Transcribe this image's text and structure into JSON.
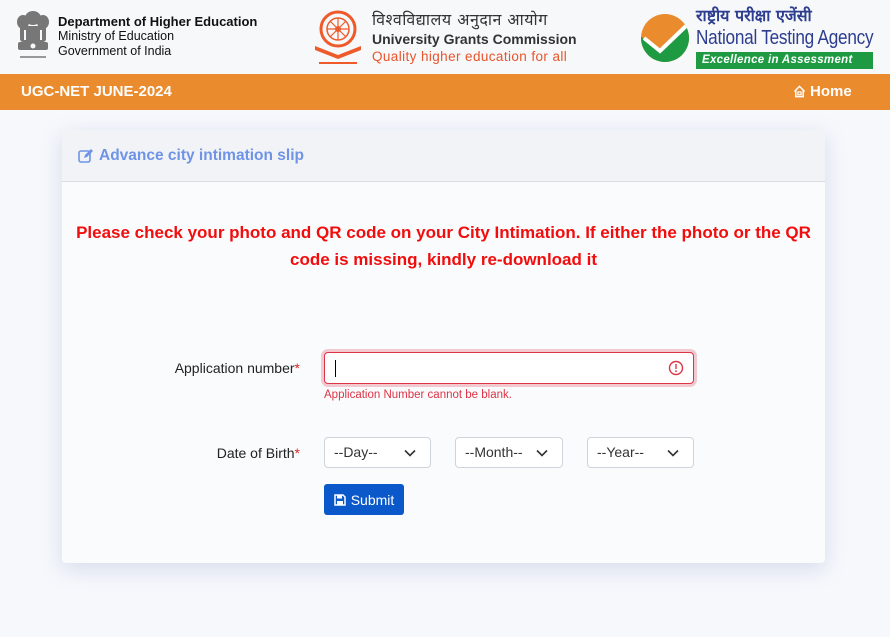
{
  "header": {
    "dhe": {
      "title": "Department of Higher Education",
      "line1": "Ministry of Education",
      "line2": "Government of India"
    },
    "ugc": {
      "hindi": "विश्वविद्यालय अनुदान आयोग",
      "english": "University Grants Commission",
      "tagline": "Quality higher education for all"
    },
    "nta": {
      "hindi": "राष्ट्रीय परीक्षा एजेंसी",
      "english": "National Testing Agency",
      "tagline": "Excellence in Assessment"
    }
  },
  "navbar": {
    "title": "UGC-NET JUNE-2024",
    "home_label": "Home",
    "color": "#ea8b2e"
  },
  "card": {
    "title": "Advance city intimation slip",
    "notice": "Please check your photo and QR code on your City Intimation. If either the photo or the QR code is missing, kindly re-download it",
    "form": {
      "application_label": "Application number",
      "required_mark": "*",
      "application_value": "",
      "application_error": "Application Number cannot be blank.",
      "dob_label": "Date of Birth",
      "day_selected": "--Day--",
      "month_selected": "--Month--",
      "year_selected": "--Year--",
      "submit_label": "Submit"
    }
  },
  "colors": {
    "error": "#dc3545",
    "notice": "#f20d0d",
    "primary": "#0a58ca",
    "card_title": "#6f93e6"
  }
}
